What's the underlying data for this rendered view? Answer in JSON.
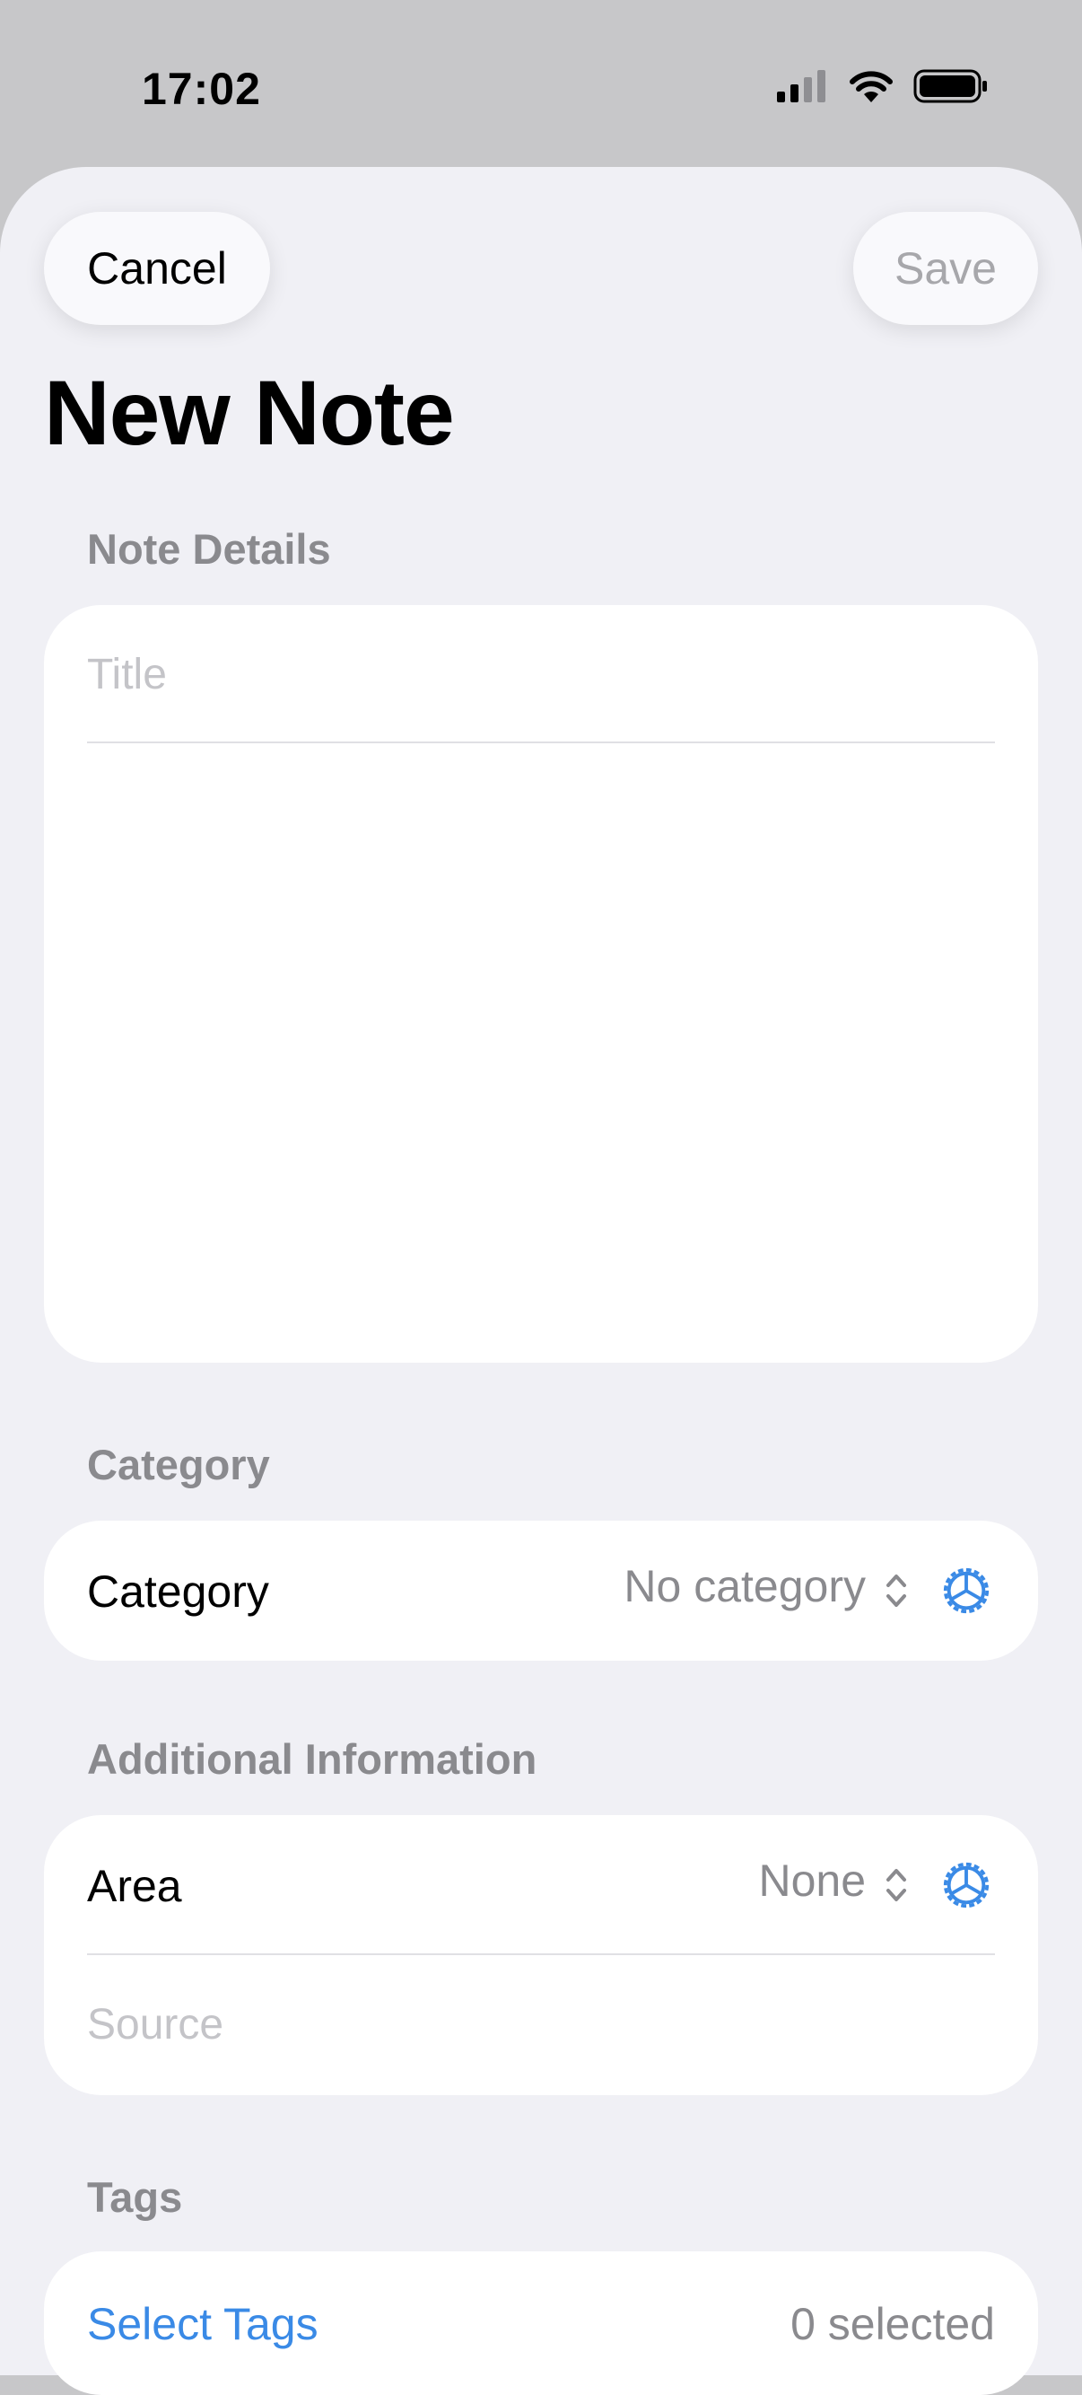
{
  "status_bar": {
    "time": "17:02"
  },
  "header": {
    "cancel_label": "Cancel",
    "save_label": "Save",
    "title": "New Note"
  },
  "note_details": {
    "section_title": "Note Details",
    "title_placeholder": "Title"
  },
  "category": {
    "section_title": "Category",
    "row_label": "Category",
    "value": "No category"
  },
  "additional_info": {
    "section_title": "Additional Information",
    "area_label": "Area",
    "area_value": "None",
    "source_placeholder": "Source"
  },
  "tags": {
    "section_title": "Tags",
    "select_label": "Select Tags",
    "count": "0 selected"
  },
  "colors": {
    "accent": "#3a8ae6",
    "secondary_text": "#8a8a8e",
    "background": "#f0f0f5"
  }
}
